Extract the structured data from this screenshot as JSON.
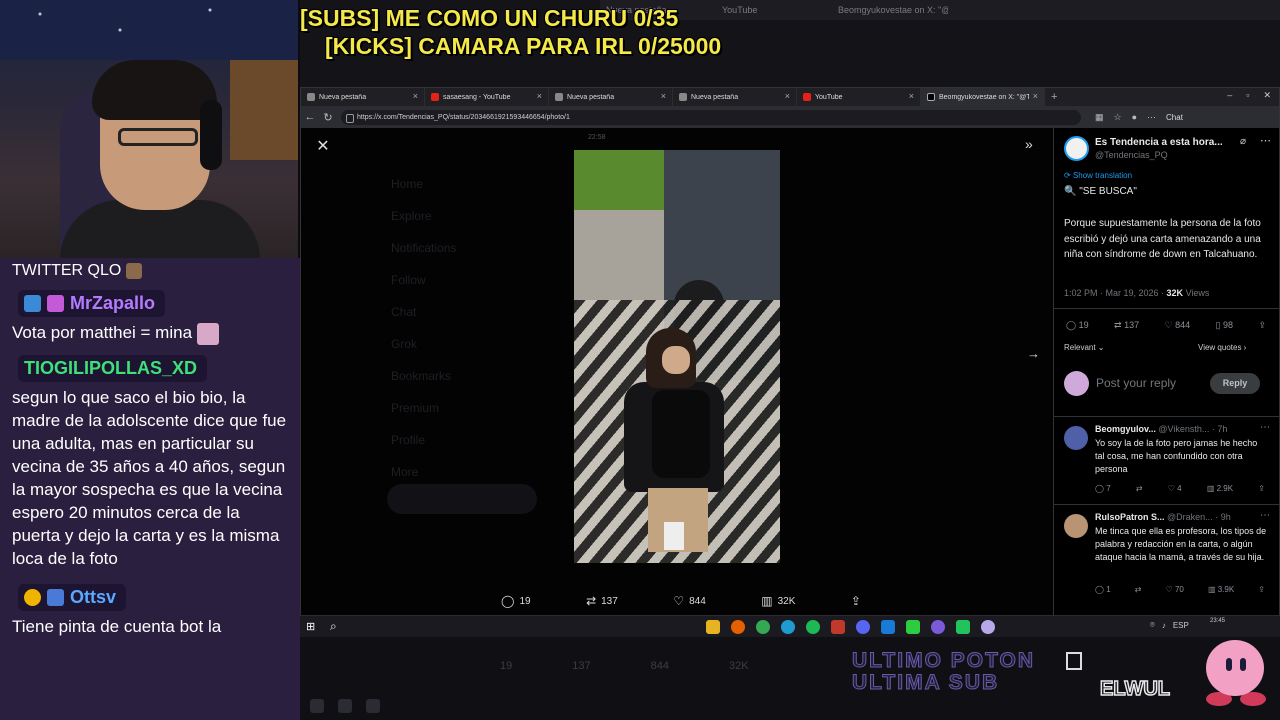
{
  "overlay": {
    "subs_goal": "[SUBS] ME COMO UN CHURU 0/35",
    "kicks_goal": "[KICKS] CAMARA PARA IRL 0/25000"
  },
  "chat": {
    "cut_message": "TWITTER QLO",
    "messages": [
      {
        "user": "MrZapallo",
        "user_color": "#b57bff",
        "text": "Vota por matthei = mina"
      },
      {
        "user": "TIOGILIPOLLAS_XD",
        "user_color": "#3fe07a",
        "text": "segun lo que saco el bio bio, la madre de la adolscente dice que fue una adulta, mas en particular su vecina de 35 años a 40 años, segun la mayor sospecha es que la vecina espero 20 minutos cerca de la puerta y dejo la carta y es la misma loca de la foto"
      },
      {
        "user": "Ottsv",
        "user_color": "#5aa8ff",
        "text": "Tiene pinta de cuenta bot la"
      }
    ]
  },
  "background": {
    "tabs": [
      "Nueva pestaña",
      "YouTube",
      "Beomgyukovestae on X: \"@Tende..."
    ],
    "bottom_stats": [
      "19",
      "137",
      "844",
      "32K"
    ]
  },
  "browser": {
    "tabs": [
      {
        "label": "Nueva pestaña",
        "icon": "new-tab-icon",
        "active": false
      },
      {
        "label": "sasaesang - YouTube",
        "icon": "youtube-icon",
        "active": false
      },
      {
        "label": "Nueva pestaña",
        "icon": "new-tab-icon",
        "active": false
      },
      {
        "label": "Nueva pestaña",
        "icon": "new-tab-icon",
        "active": false
      },
      {
        "label": "YouTube",
        "icon": "youtube-icon",
        "active": false
      },
      {
        "label": "Beomgyukovestae on X: \"@Tende...",
        "icon": "x-icon",
        "active": true
      }
    ],
    "url": "https://x.com/Tendencias_PQ/status/2034661921593446654/photo/1",
    "chat_label": "Chat"
  },
  "viewer": {
    "top_time": "22:58",
    "ghost_nav": [
      "Home",
      "Explore",
      "Notifications",
      "Follow",
      "Chat",
      "Grok",
      "Bookmarks",
      "Premium",
      "Profile",
      "More"
    ],
    "actions": {
      "replies": "19",
      "reposts": "137",
      "likes": "844",
      "views": "32K"
    }
  },
  "post": {
    "name": "Es Tendencia a esta hora...",
    "handle": "@Tendencias_PQ",
    "show_translation": "Show translation",
    "headline": "🔍 \"SE BUSCA\"",
    "body": "Porque supuestamente la persona de la foto escribió y dejó una carta amenazando a una niña con síndrome de down en Talcahuano.",
    "time": "1:02 PM · Mar 19, 2026 · ",
    "views_count": "32K",
    "views_label": " Views",
    "stats": {
      "replies": "19",
      "reposts": "137",
      "likes": "844",
      "bookmarks": "98"
    },
    "sort": "Relevant",
    "view_quotes": "View quotes",
    "reply_placeholder": "Post your reply",
    "reply_button": "Reply",
    "replies": [
      {
        "name": "Beomgyulov...",
        "handle": "@Vikensth...",
        "age": "· 7h",
        "text": "Yo soy la de la foto pero jamas he hecho tal cosa, me han confundido con otra persona",
        "replies": "7",
        "reposts": "",
        "likes": "4",
        "views": "2.9K"
      },
      {
        "name": "RulsoPatron S...",
        "handle": "@Draken...",
        "age": "· 9h",
        "text": "Me tinca que ella es profesora, los tipos de palabra y redacción en la carta, o algún ataque hacia la mamá, a través de su hija.",
        "replies": "1",
        "reposts": "",
        "likes": "70",
        "views": "3.9K"
      }
    ]
  },
  "taskbar": {
    "tray_lang": "ESP",
    "clock": "23:45"
  },
  "stream_overlay": {
    "alert_line1": "ULTIMO POTON",
    "alert_line2": "ULTIMA SUB",
    "brand": "ELWUL"
  },
  "colors": {
    "overlay_yellow": "#f4e84a",
    "chat_bg": "#2a1f3e",
    "x_blue": "#1d9bf0"
  }
}
